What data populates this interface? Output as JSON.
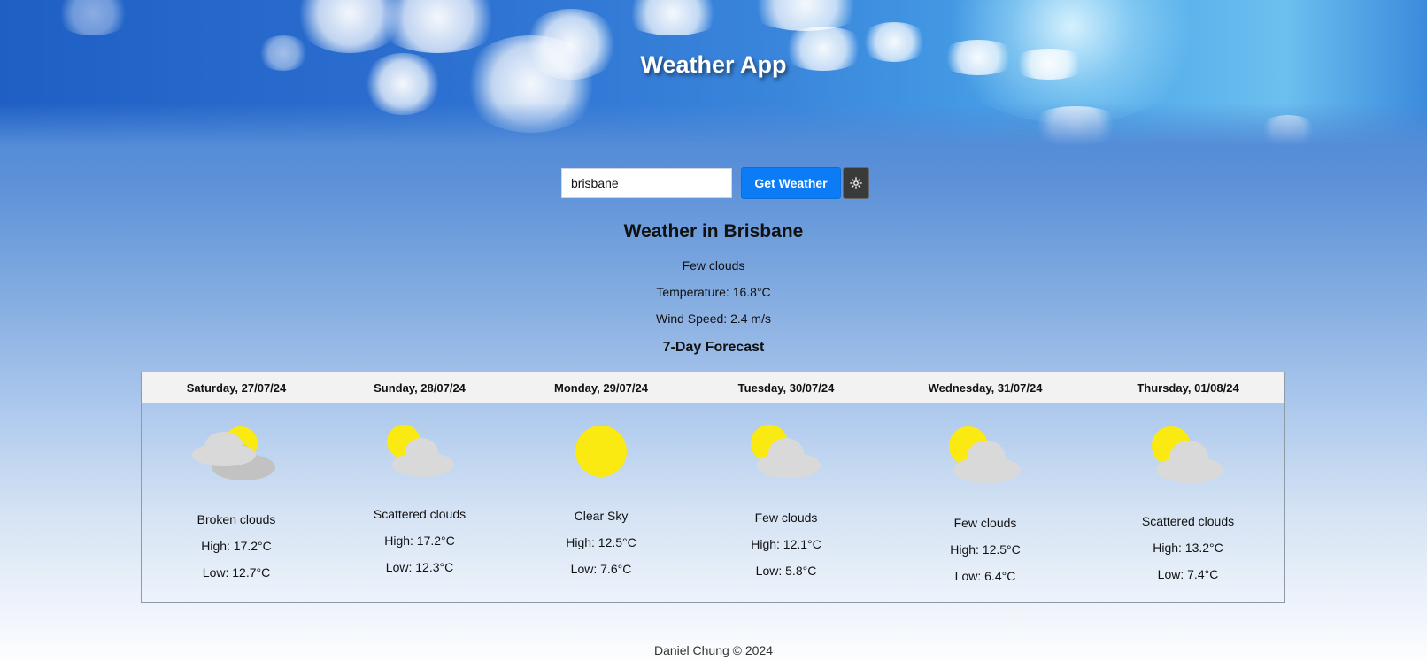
{
  "app": {
    "title": "Weather App"
  },
  "search": {
    "value": "brisbane",
    "button_label": "Get Weather",
    "theme_toggle_icon": "sun-icon"
  },
  "current": {
    "heading": "Weather in Brisbane",
    "description": "Few clouds",
    "temperature": "Temperature: 16.8°C",
    "wind": "Wind Speed: 2.4 m/s"
  },
  "forecast": {
    "heading": "7-Day Forecast",
    "days": [
      {
        "day": "Saturday, 27/07/24",
        "icon": "broken-clouds-icon",
        "description": "Broken clouds",
        "high": "High: 17.2°C",
        "low": "Low: 12.7°C"
      },
      {
        "day": "Sunday, 28/07/24",
        "icon": "scattered-clouds-icon",
        "description": "Scattered clouds",
        "high": "High: 17.2°C",
        "low": "Low: 12.3°C"
      },
      {
        "day": "Monday, 29/07/24",
        "icon": "clear-sky-icon",
        "description": "Clear Sky",
        "high": "High: 12.5°C",
        "low": "Low: 7.6°C"
      },
      {
        "day": "Tuesday, 30/07/24",
        "icon": "few-clouds-icon",
        "description": "Few clouds",
        "high": "High: 12.1°C",
        "low": "Low: 5.8°C"
      },
      {
        "day": "Wednesday, 31/07/24",
        "icon": "few-clouds-icon",
        "description": "Few clouds",
        "high": "High: 12.5°C",
        "low": "Low: 6.4°C"
      },
      {
        "day": "Thursday, 01/08/24",
        "icon": "scattered-clouds-icon",
        "description": "Scattered clouds",
        "high": "High: 13.2°C",
        "low": "Low: 7.4°C"
      }
    ]
  },
  "colors": {
    "sun": "#fbe912",
    "cloud_light": "#d9d9d9",
    "cloud_dark": "#c2c2c2",
    "button_blue": "#0b7cf5",
    "theme_button": "#3a3a3a"
  },
  "footer": {
    "text": "Daniel Chung © 2024"
  }
}
